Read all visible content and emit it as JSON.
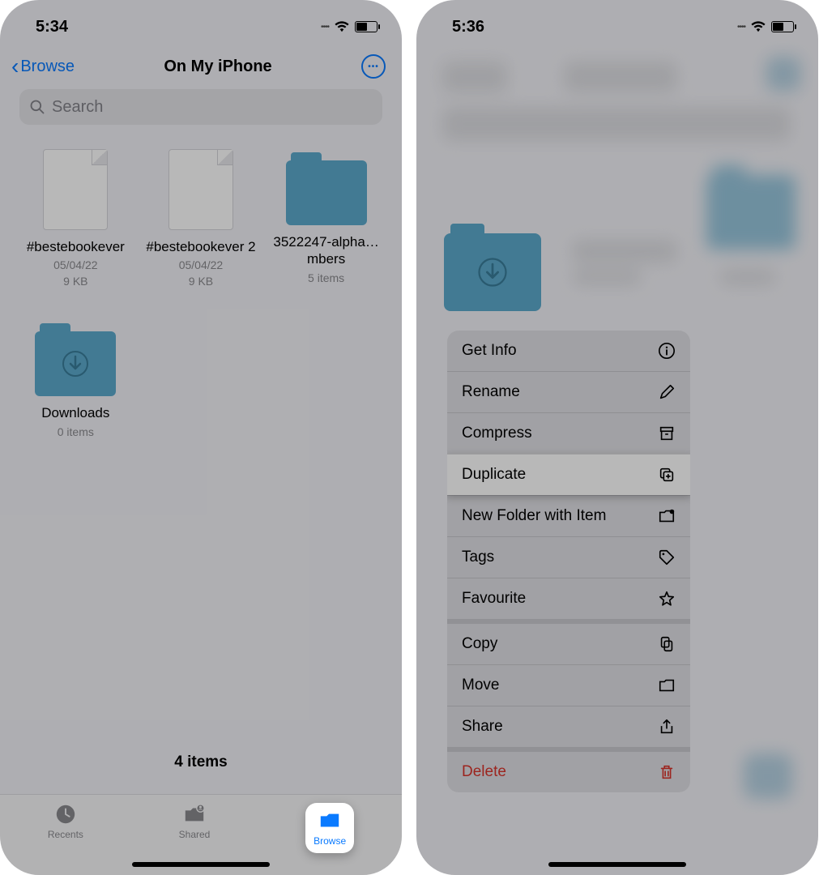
{
  "left": {
    "status": {
      "time": "5:34"
    },
    "nav": {
      "back": "Browse",
      "title": "On My iPhone"
    },
    "search": {
      "placeholder": "Search"
    },
    "items": [
      {
        "name": "#bestebookever",
        "date": "05/04/22",
        "size": "9 KB",
        "type": "file"
      },
      {
        "name": "#bestebookever 2",
        "date": "05/04/22",
        "size": "9 KB",
        "type": "file"
      },
      {
        "name": "3522247-alpha…mbers",
        "meta": "5 items",
        "type": "folder"
      },
      {
        "name": "Downloads",
        "meta": "0 items",
        "type": "folder-dl"
      }
    ],
    "summary": "4 items",
    "tabs": {
      "recents": "Recents",
      "shared": "Shared",
      "browse": "Browse"
    }
  },
  "right": {
    "status": {
      "time": "5:36"
    },
    "menu": {
      "g1": [
        {
          "label": "Get Info",
          "icon": "info"
        },
        {
          "label": "Rename",
          "icon": "pencil"
        },
        {
          "label": "Compress",
          "icon": "archive"
        },
        {
          "label": "Duplicate",
          "icon": "duplicate",
          "highlight": true
        },
        {
          "label": "New Folder with Item",
          "icon": "newfolder"
        },
        {
          "label": "Tags",
          "icon": "tag"
        },
        {
          "label": "Favourite",
          "icon": "star"
        }
      ],
      "g2": [
        {
          "label": "Copy",
          "icon": "copy"
        },
        {
          "label": "Move",
          "icon": "folder"
        },
        {
          "label": "Share",
          "icon": "share"
        }
      ],
      "g3": [
        {
          "label": "Delete",
          "icon": "trash",
          "danger": true
        }
      ]
    }
  }
}
